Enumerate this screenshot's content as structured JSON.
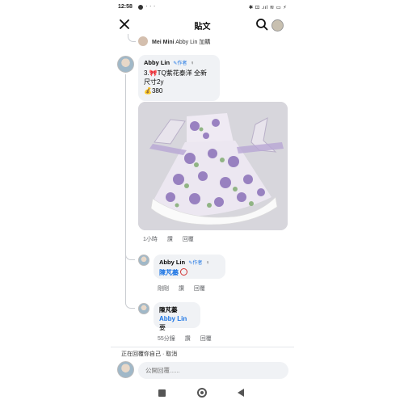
{
  "status_bar": {
    "time": "12:58",
    "dots": "· · ·",
    "icons_text": "✱ ⊡ .ııl ≋ ▭ ⚡"
  },
  "header": {
    "title": "貼文"
  },
  "reply_summary": {
    "name": "Mei Mini",
    "text": "Abby Lin 加購"
  },
  "main_comment": {
    "author": "Abby Lin",
    "author_badge": "作者",
    "line1": "3.🎀TQ紫花泰洋 全新",
    "line2": "尺寸2y",
    "line3": "💰380",
    "time": "1小時",
    "like": "讚",
    "reply": "回覆"
  },
  "reply1": {
    "author": "Abby Lin",
    "author_badge": "作者",
    "mention": "陳芃蓁",
    "time": "剛剛",
    "like": "讚",
    "reply": "回覆"
  },
  "reply2": {
    "author": "陳芃蓁",
    "mention": "Abby Lin",
    "text_after": "要",
    "time": "55分鐘",
    "like": "讚",
    "reply": "回覆"
  },
  "composer": {
    "replying_to": "正在回覆你自己 · 取消",
    "placeholder": "公開回覆......"
  },
  "icons": [
    "close-icon",
    "search-icon",
    "author-pencil-icon",
    "top-fan-badge-icon",
    "nav-recent-icon",
    "nav-home-icon",
    "nav-back-icon"
  ],
  "colors": {
    "link_blue": "#1b74e4",
    "bubble_bg": "#f0f2f5",
    "meta_gray": "#65676b"
  }
}
